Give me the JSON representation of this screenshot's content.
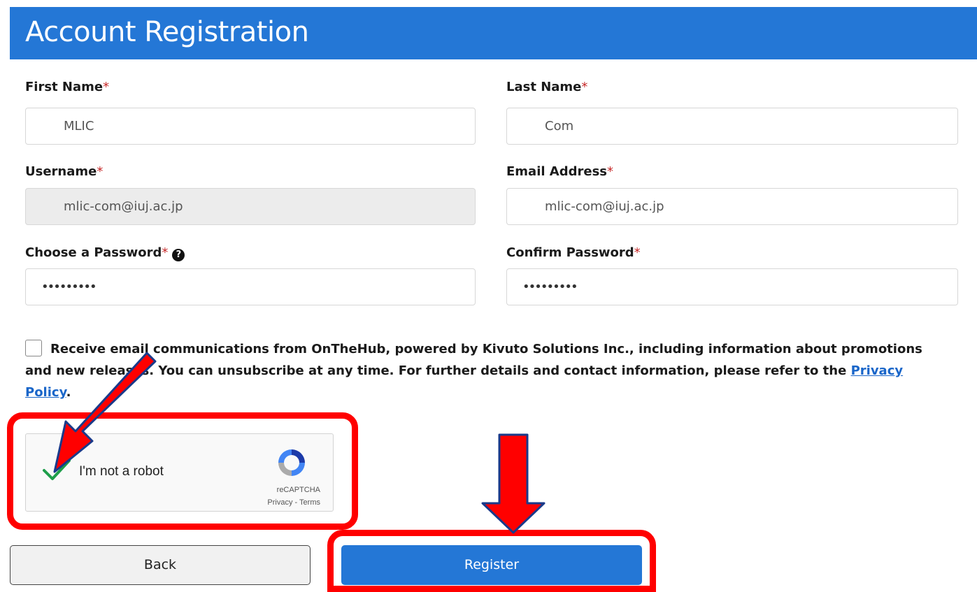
{
  "header": {
    "title": "Account Registration"
  },
  "form": {
    "first_name": {
      "label": "First Name",
      "value": "MLIC"
    },
    "last_name": {
      "label": "Last Name",
      "value": "Com"
    },
    "username": {
      "label": "Username",
      "value": "mlic-com@iuj.ac.jp"
    },
    "email": {
      "label": "Email Address",
      "value": "mlic-com@iuj.ac.jp"
    },
    "password": {
      "label": "Choose a Password",
      "value": "•••••••••"
    },
    "confirm_password": {
      "label": "Confirm Password",
      "value": "•••••••••"
    },
    "required_marker": "*",
    "help_glyph": "?"
  },
  "consent": {
    "text": "Receive email communications from OnTheHub, powered by Kivuto Solutions Inc., including information about promotions and new releases. You can unsubscribe at any time. For further details and contact information, please refer to the ",
    "link": "Privacy Policy",
    "end": "."
  },
  "captcha": {
    "label": "I'm not a robot",
    "brand": "reCAPTCHA",
    "privacy": "Privacy",
    "separator": " - ",
    "terms": "Terms",
    "checked": true
  },
  "buttons": {
    "back": "Back",
    "register": "Register"
  },
  "colors": {
    "header": "#2477d6",
    "annotation": "#ff0000",
    "check": "#1e9e4a"
  }
}
